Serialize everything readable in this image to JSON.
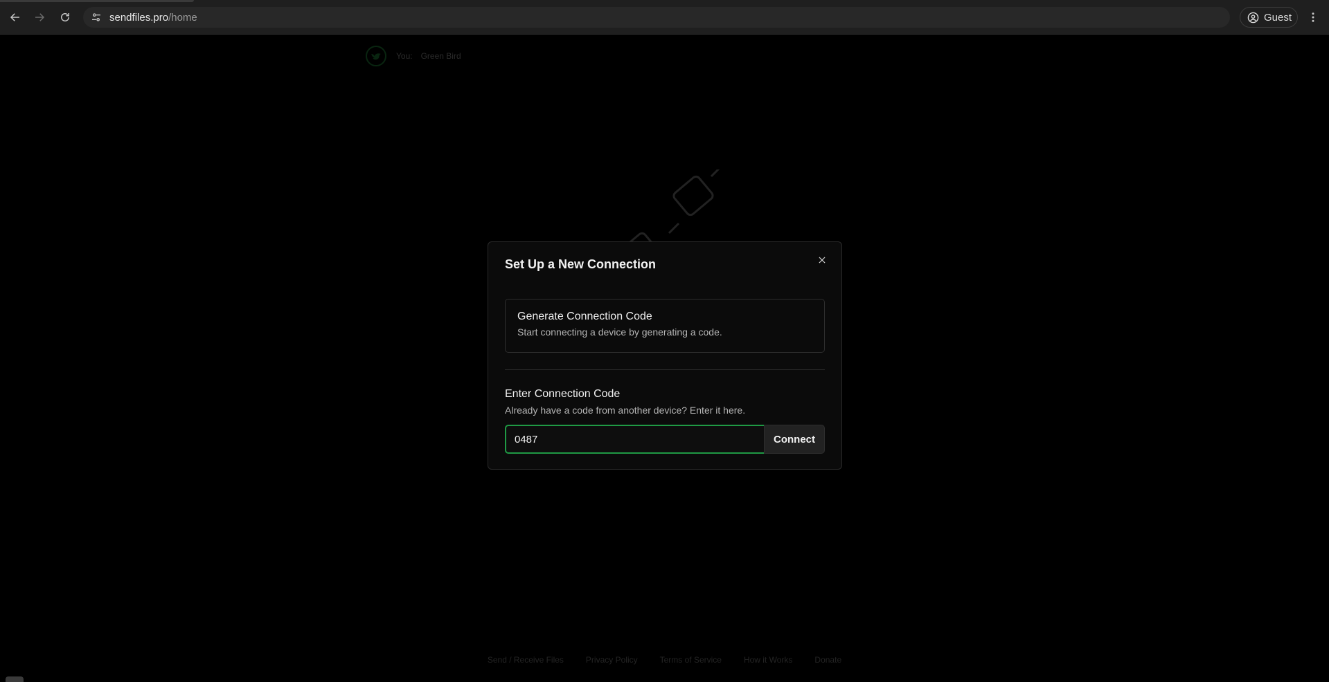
{
  "browser": {
    "url_host": "sendfiles.pro",
    "url_path": "/home",
    "profile_label": "Guest"
  },
  "page": {
    "you_label": "You:",
    "user_name": "Green Bird",
    "footer_links": [
      "Send / Receive Files",
      "Privacy Policy",
      "Terms of Service",
      "How it Works",
      "Donate"
    ]
  },
  "modal": {
    "title": "Set Up a New Connection",
    "generate_title": "Generate Connection Code",
    "generate_subtitle": "Start connecting a device by generating a code.",
    "enter_title": "Enter Connection Code",
    "enter_subtitle": "Already have a code from another device? Enter it here.",
    "code_value": "0487",
    "connect_label": "Connect"
  },
  "colors": {
    "accent": "#1f9a44",
    "background": "#000000"
  }
}
